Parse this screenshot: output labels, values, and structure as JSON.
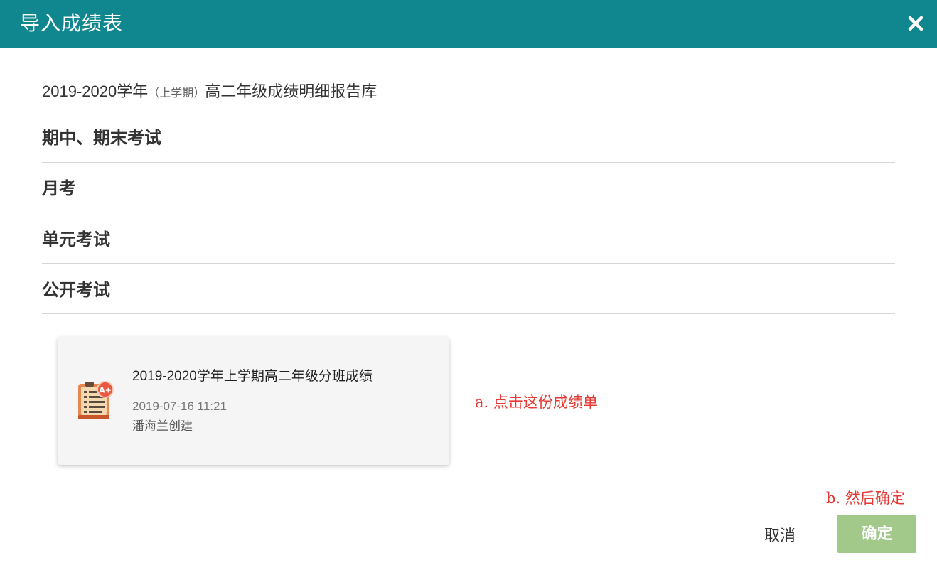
{
  "dialog": {
    "title": "导入成绩表",
    "close_icon": "close-icon"
  },
  "library": {
    "year": "2019-2020学年",
    "term": "（上学期）",
    "name": "高二年级成绩明细报告库"
  },
  "categories": [
    {
      "label": "期中、期末考试"
    },
    {
      "label": "月考"
    },
    {
      "label": "单元考试"
    },
    {
      "label": "公开考试"
    }
  ],
  "report_card": {
    "icon": "report-card-icon",
    "title": "2019-2020学年上学期高二年级分班成绩",
    "time": "2019-07-16 11:21",
    "creator": "潘海兰创建"
  },
  "annotations": {
    "step_a": "a. 点击这份成绩单",
    "step_b": "b. 然后确定"
  },
  "footer": {
    "cancel_label": "取消",
    "ok_label": "确定"
  },
  "colors": {
    "header": "#10868f",
    "ok_button": "#a3c98a",
    "annotation": "#e53935"
  }
}
